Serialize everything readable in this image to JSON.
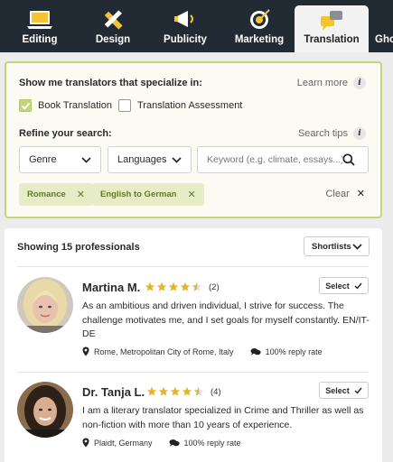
{
  "nav": {
    "tabs": [
      {
        "label": "Editing",
        "icon": "laptop-icon"
      },
      {
        "label": "Design",
        "icon": "pencil-ruler-icon"
      },
      {
        "label": "Publicity",
        "icon": "megaphone-icon"
      },
      {
        "label": "Marketing",
        "icon": "target-icon"
      },
      {
        "label": "Translation",
        "icon": "translation-bubbles-icon"
      },
      {
        "label": "Gho",
        "icon": "none"
      }
    ],
    "active_tab": "Translation"
  },
  "filter": {
    "title": "Show me translators that specialize in:",
    "learn_more": "Learn more",
    "checkboxes": [
      {
        "label": "Book Translation",
        "checked": true
      },
      {
        "label": "Translation Assessment",
        "checked": false
      }
    ],
    "refine_title": "Refine your search:",
    "search_tips": "Search tips",
    "genre_dropdown": "Genre",
    "languages_dropdown": "Languages",
    "keyword_placeholder": "Keyword (e.g. climate, essays...)",
    "chips": [
      "Romance",
      "English to German"
    ],
    "clear": "Clear"
  },
  "results": {
    "count_text": "Showing 15 professionals",
    "shortlists_label": "Shortlists",
    "select_label": "Select",
    "professionals": [
      {
        "name": "Martina M.",
        "rating": 4.5,
        "review_count": "(2)",
        "bio": "As an ambitious and driven individual, I strive for success. The challenge motivates me, and I set goals for myself constantly. EN/IT- DE",
        "location": "Rome, Metropolitan City of Rome, Italy",
        "reply_rate": "100% reply rate"
      },
      {
        "name": "Dr. Tanja L.",
        "rating": 4.5,
        "review_count": "(4)",
        "bio": "I am a literary translator specialized in Crime and Thriller as well as non-fiction with more than 10 years of experience.",
        "location": "Plaidt, Germany",
        "reply_rate": "100% reply rate"
      }
    ]
  },
  "colors": {
    "nav_bg": "#222b33",
    "accent_green": "#c3d77a",
    "chip_bg": "#e6edc6",
    "chip_text": "#5f7d1e",
    "star_gold": "#e0b62c"
  }
}
